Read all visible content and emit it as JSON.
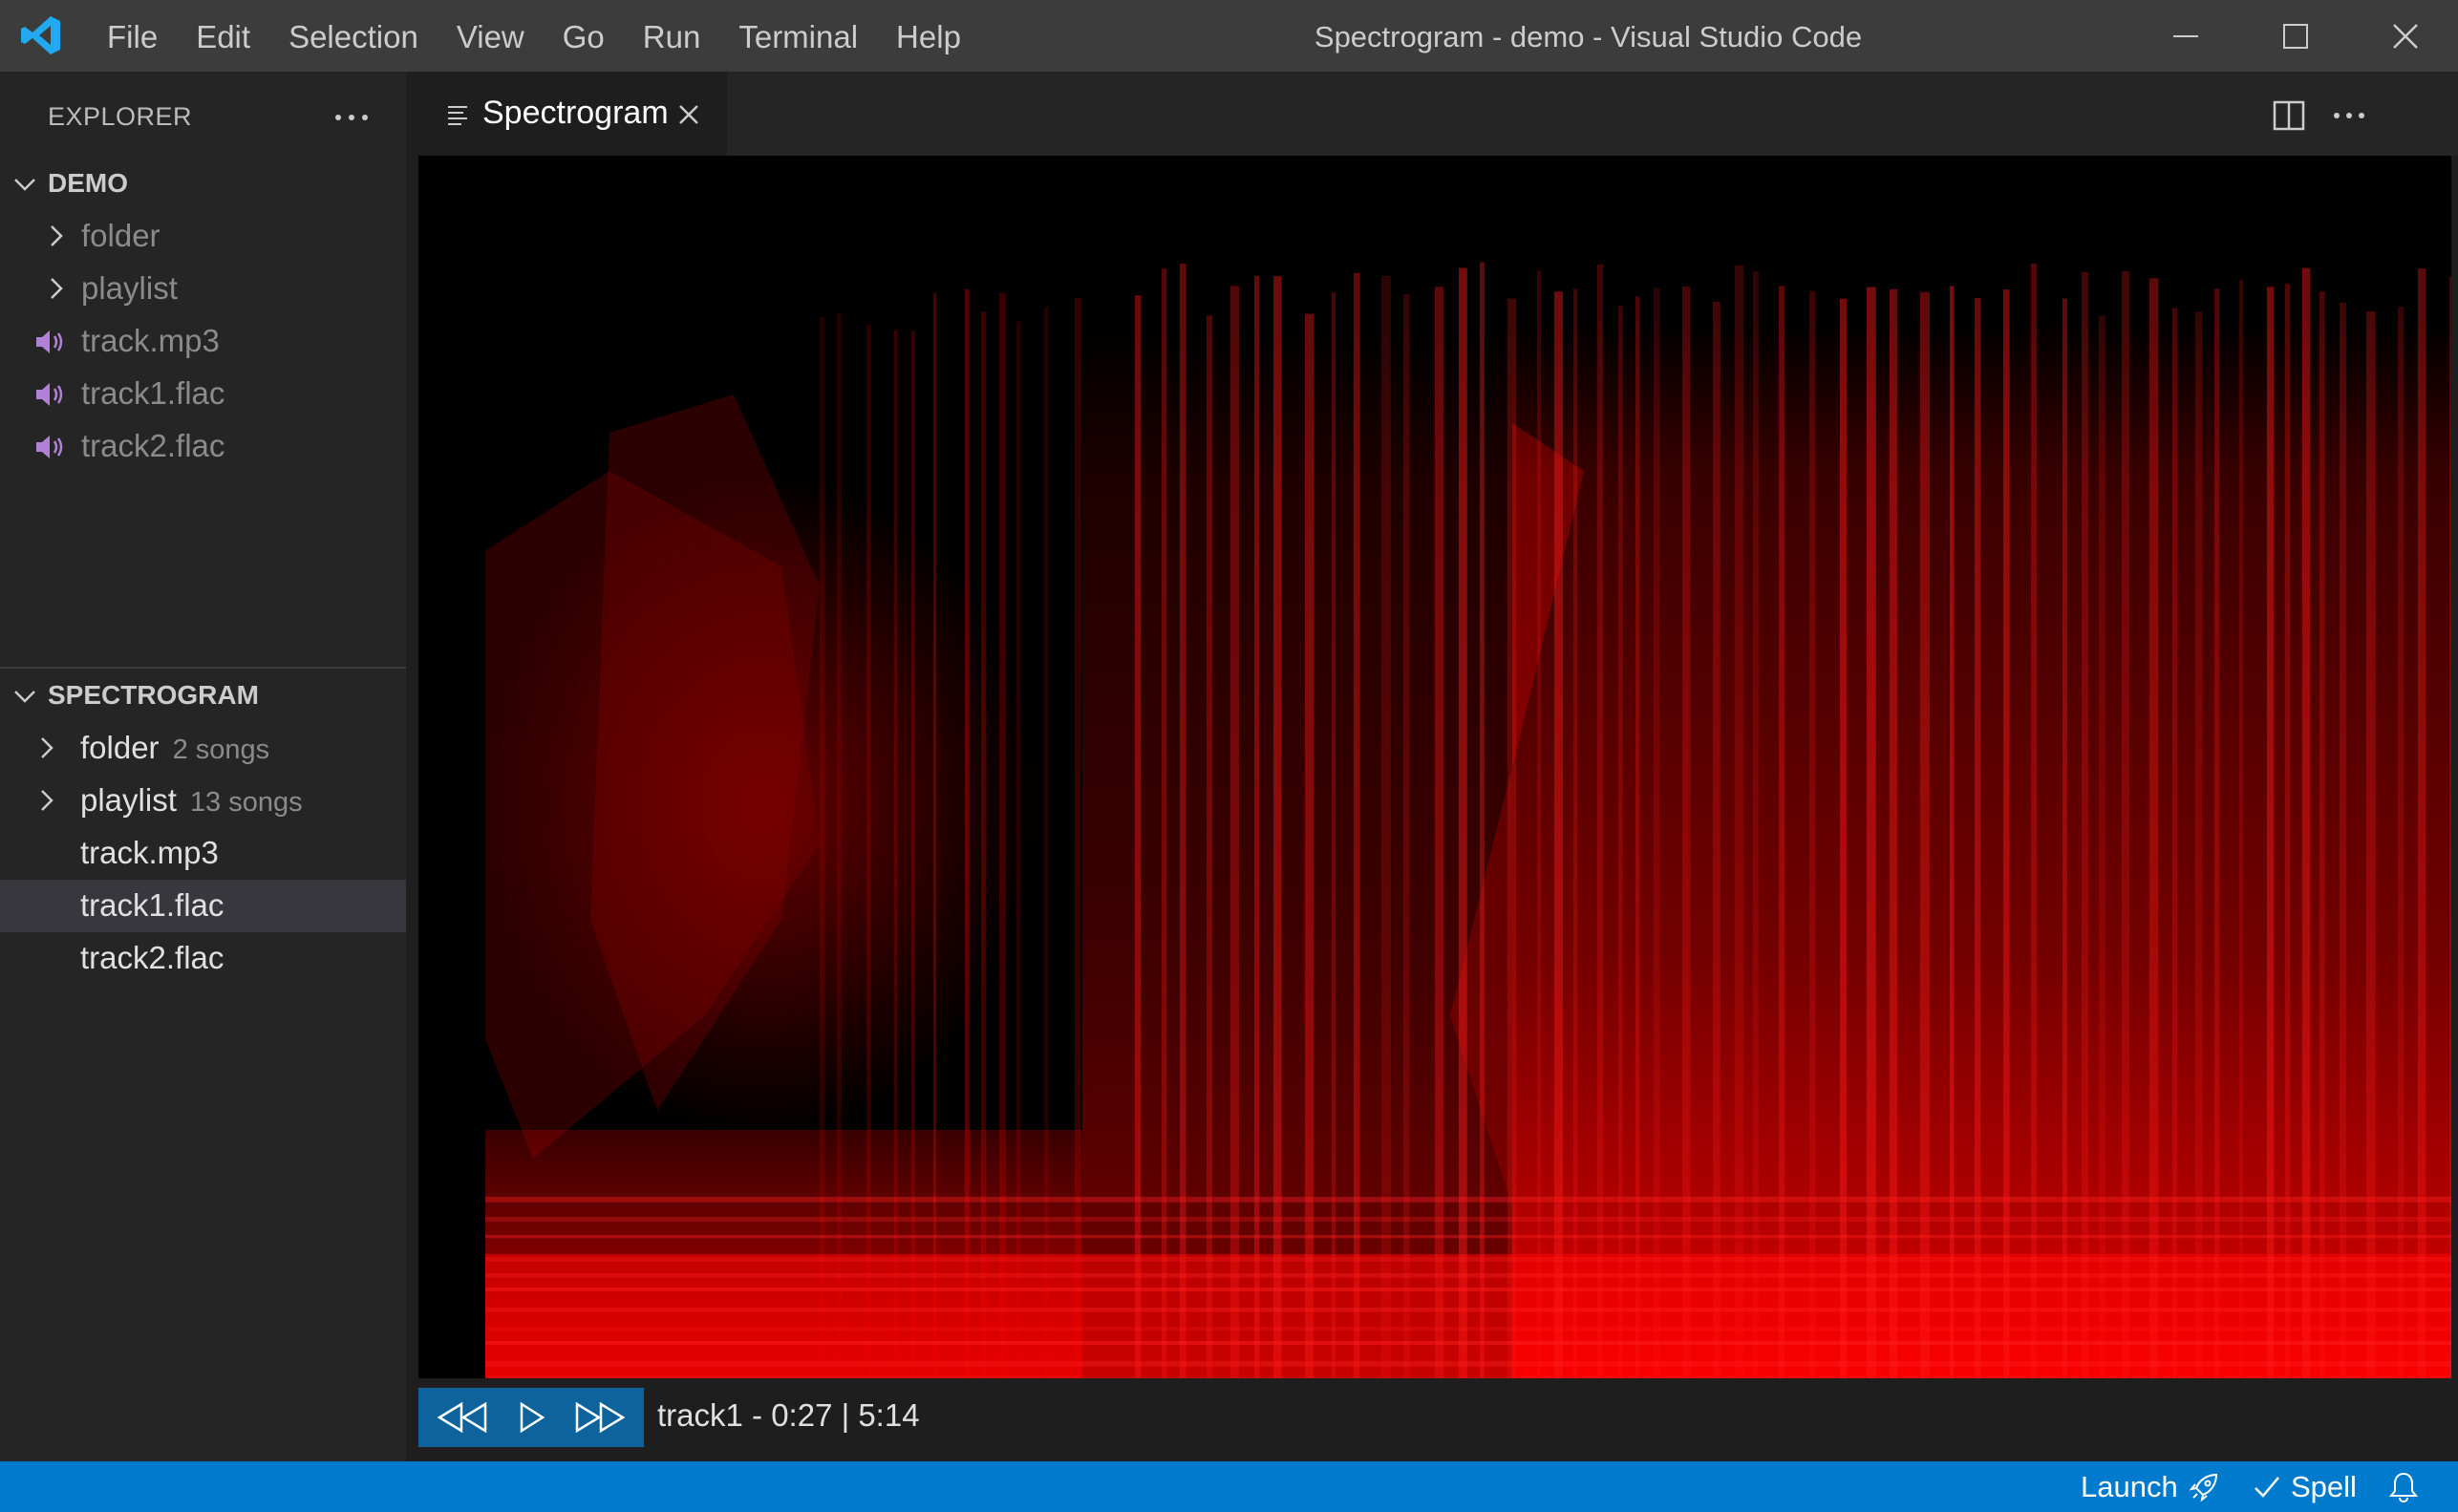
{
  "window": {
    "title": "Spectrogram - demo - Visual Studio Code",
    "menu": [
      "File",
      "Edit",
      "Selection",
      "View",
      "Go",
      "Run",
      "Terminal",
      "Help"
    ]
  },
  "sidebar": {
    "title": "EXPLORER",
    "demo": {
      "title": "DEMO",
      "items": [
        {
          "label": "folder",
          "kind": "folder"
        },
        {
          "label": "playlist",
          "kind": "folder"
        },
        {
          "label": "track.mp3",
          "kind": "audio"
        },
        {
          "label": "track1.flac",
          "kind": "audio"
        },
        {
          "label": "track2.flac",
          "kind": "audio"
        }
      ]
    },
    "spectrogram": {
      "title": "SPECTROGRAM",
      "items": [
        {
          "label": "folder",
          "desc": "2 songs",
          "kind": "folder"
        },
        {
          "label": "playlist",
          "desc": "13 songs",
          "kind": "folder"
        },
        {
          "label": "track.mp3",
          "kind": "file"
        },
        {
          "label": "track1.flac",
          "kind": "file",
          "selected": true
        },
        {
          "label": "track2.flac",
          "kind": "file"
        }
      ]
    }
  },
  "editor": {
    "tab": {
      "label": "Spectrogram"
    },
    "player": {
      "track": "track1",
      "position": "0:27",
      "duration": "5:14",
      "info": "track1  - 0:27 | 5:14"
    }
  },
  "statusbar": {
    "launch": "Launch",
    "spell": "Spell"
  },
  "colors": {
    "accent": "#007acc",
    "spectrogram": "#ff0000",
    "audio_icon": "#b180d7"
  },
  "icons": [
    "vscode-logo-icon",
    "chevron-right-icon",
    "chevron-down-icon",
    "audio-file-icon",
    "close-icon",
    "split-editor-icon",
    "more-icon",
    "rewind-icon",
    "play-icon",
    "fast-forward-icon",
    "rocket-icon",
    "check-icon",
    "bell-icon"
  ]
}
